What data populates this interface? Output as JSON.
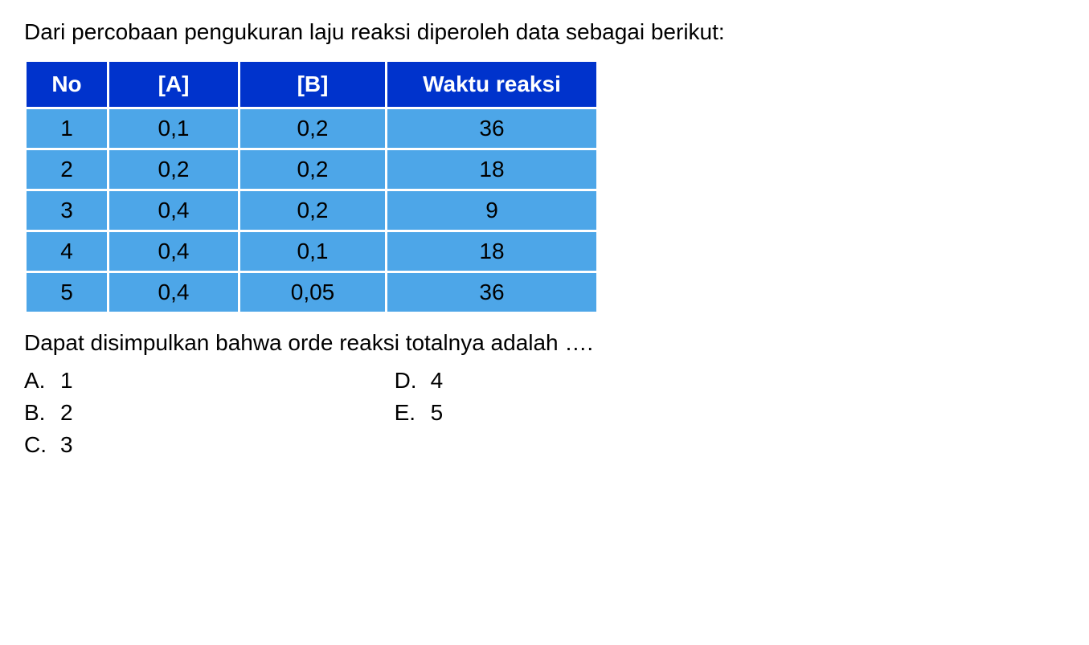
{
  "question_text": "Dari percobaan pengukuran laju reaksi diperoleh data sebagai berikut:",
  "table": {
    "headers": [
      "No",
      "[A]",
      "[B]",
      "Waktu reaksi"
    ],
    "rows": [
      [
        "1",
        "0,1",
        "0,2",
        "36"
      ],
      [
        "2",
        "0,2",
        "0,2",
        "18"
      ],
      [
        "3",
        "0,4",
        "0,2",
        "9"
      ],
      [
        "4",
        "0,4",
        "0,1",
        "18"
      ],
      [
        "5",
        "0,4",
        "0,05",
        "36"
      ]
    ]
  },
  "conclusion_text": "Dapat disimpulkan bahwa orde reaksi totalnya adalah ….",
  "options_left": [
    {
      "letter": "A.",
      "value": "1"
    },
    {
      "letter": "B.",
      "value": "2"
    },
    {
      "letter": "C.",
      "value": "3"
    }
  ],
  "options_right": [
    {
      "letter": "D.",
      "value": "4"
    },
    {
      "letter": "E.",
      "value": "5"
    }
  ]
}
